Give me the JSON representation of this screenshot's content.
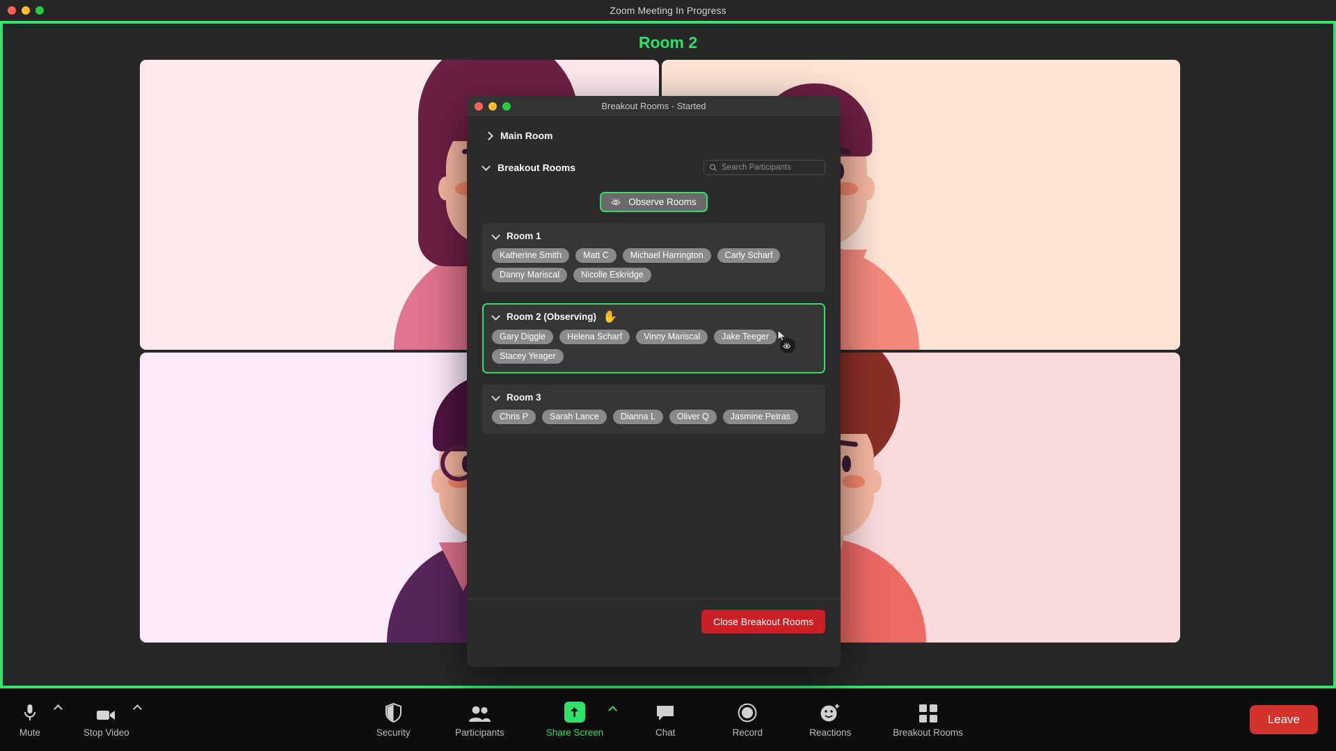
{
  "window": {
    "title": "Zoom Meeting In Progress",
    "traffic_lights": [
      "close-red",
      "minimize-yellow",
      "maximize-green"
    ]
  },
  "stage": {
    "room_label": "Room 2",
    "accent_color": "#36e36b",
    "tiles": [
      {
        "name": "participant-tile-1",
        "bg": "#fce9ec",
        "hair": "#6e1f45",
        "shirt": "#e0738f",
        "style": "long-hair"
      },
      {
        "name": "participant-tile-2",
        "bg": "#fde4d5",
        "hair": "#6e1f45",
        "shirt": "#f4887c",
        "style": "collar"
      },
      {
        "name": "participant-tile-3",
        "bg": "#fbeafb",
        "hair": "#4f1340",
        "shirt": "#57255a",
        "style": "glasses-tie"
      },
      {
        "name": "participant-tile-4",
        "bg": "#fadadd",
        "hair": "#8a2f27",
        "shirt": "#ec6a63",
        "style": "curly"
      }
    ]
  },
  "dialog": {
    "title": "Breakout Rooms - Started",
    "traffic_lights": [
      "close-red",
      "minimize-yellow",
      "maximize-green"
    ],
    "main_room_label": "Main Room",
    "breakout_rooms_label": "Breakout Rooms",
    "search": {
      "placeholder": "Search Participants",
      "value": "",
      "icon": "search-icon"
    },
    "observe_button": {
      "label": "Observe Rooms",
      "icon": "eye-icon",
      "border_color": "#2fe06a"
    },
    "rooms": [
      {
        "name": "Room 1",
        "observing": false,
        "hand_raised": false,
        "participants": [
          "Katherine Smith",
          "Matt C",
          "Michael Harrington",
          "Carly Scharf",
          "Danny Mariscal",
          "Nicolle Eskridge"
        ]
      },
      {
        "name": "Room 2 (Observing)",
        "observing": true,
        "hand_raised": true,
        "hand_emoji": "✋",
        "participants": [
          "Gary Diggle",
          "Helena Scharf",
          "Vinny Mariscal",
          "Jake Teeger",
          "Stacey Yeager"
        ]
      },
      {
        "name": "Room 3",
        "observing": false,
        "hand_raised": false,
        "participants": [
          "Chris P",
          "Sarah Lance",
          "Dianna L",
          "Oliver Q",
          "Jasmine Petras"
        ]
      }
    ],
    "close_button": {
      "label": "Close Breakout Rooms",
      "color": "#cc2026"
    }
  },
  "toolbar": {
    "left": [
      {
        "label": "Mute",
        "icon": "microphone-icon",
        "has_caret": true,
        "active": false
      },
      {
        "label": "Stop Video",
        "icon": "video-camera-icon",
        "has_caret": true,
        "active": false
      }
    ],
    "center": [
      {
        "label": "Security",
        "icon": "shield-icon",
        "has_caret": false,
        "active": false
      },
      {
        "label": "Participants",
        "icon": "people-icon",
        "has_caret": false,
        "active": false
      },
      {
        "label": "Share Screen",
        "icon": "share-screen-icon",
        "has_caret": true,
        "active": true
      },
      {
        "label": "Chat",
        "icon": "chat-bubble-icon",
        "has_caret": false,
        "active": false
      },
      {
        "label": "Record",
        "icon": "record-circle-icon",
        "has_caret": false,
        "active": false
      },
      {
        "label": "Reactions",
        "icon": "smiley-plus-icon",
        "has_caret": false,
        "active": false
      },
      {
        "label": "Breakout Rooms",
        "icon": "grid-squares-icon",
        "has_caret": false,
        "active": false
      }
    ],
    "leave_button": {
      "label": "Leave",
      "color": "#d0342c"
    }
  }
}
